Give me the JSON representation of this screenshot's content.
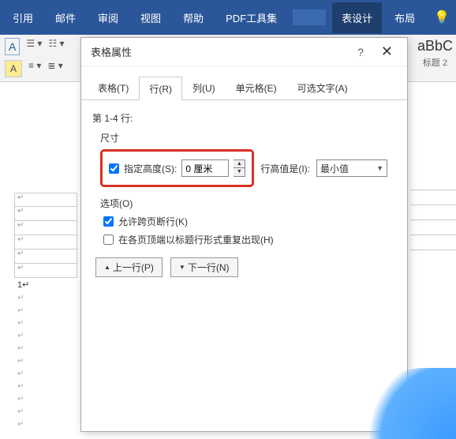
{
  "ribbon": {
    "tabs": [
      "引用",
      "邮件",
      "审阅",
      "视图",
      "帮助",
      "PDF工具集"
    ],
    "rightTabs": [
      "表设计",
      "布局"
    ],
    "stylePreview": "aBbC",
    "styleLabel": "标题 2"
  },
  "dialog": {
    "title": "表格属性",
    "help": "?",
    "tabs": {
      "table": "表格(T)",
      "row": "行(R)",
      "col": "列(U)",
      "cell": "单元格(E)",
      "alt": "可选文字(A)"
    },
    "rowRange": "第 1-4 行:",
    "sizeLabel": "尺寸",
    "specifyHeight": "指定高度(S):",
    "heightValue": "0 厘米",
    "heightModeLabel": "行高值是(I):",
    "heightModeValue": "最小值",
    "optionsLabel": "选项(O)",
    "allowBreak": "允许跨页断行(K)",
    "repeatHeader": "在各页顶端以标题行形式重复出现(H)",
    "prevRow": "上一行(P)",
    "nextRow": "下一行(N)"
  },
  "doc": {
    "rowMarker": "1"
  }
}
